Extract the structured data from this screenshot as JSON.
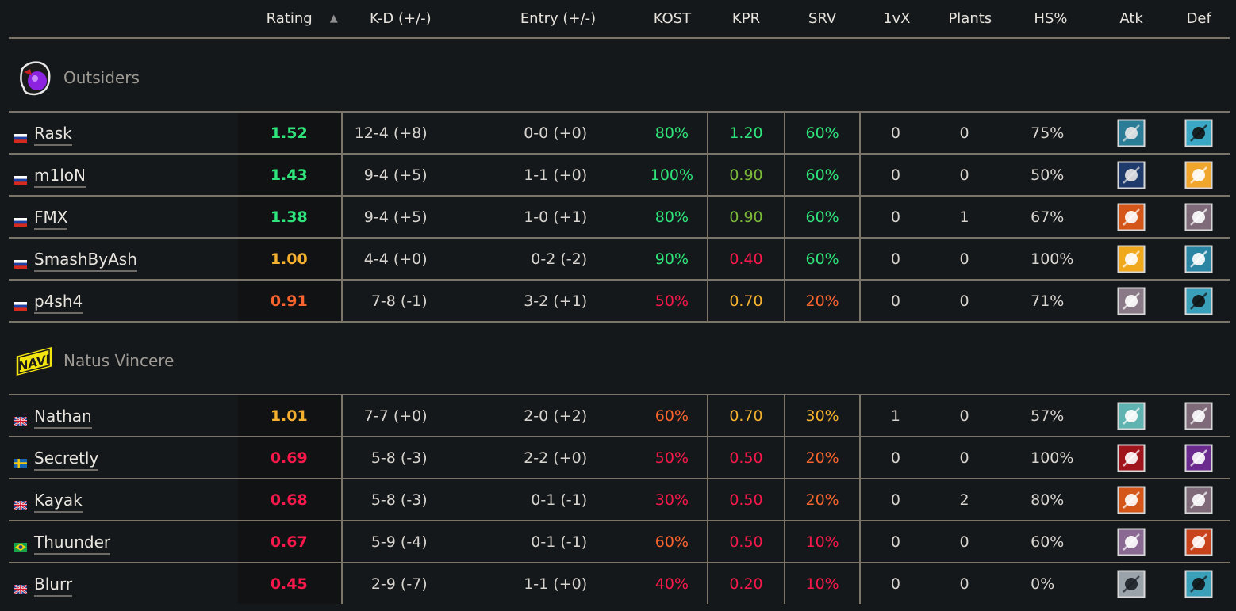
{
  "colors": {
    "green": "#2fe47a",
    "light_green": "#7bb93b",
    "yellow": "#f4b02e",
    "orange": "#f7642e",
    "red": "#f5184a",
    "neutral": "#d8d4cf",
    "background": "#15181b",
    "divider": "#7b7468"
  },
  "headers": {
    "player": "",
    "rating": "Rating",
    "rating_sort": "▲",
    "kd": "K-D (+/-)",
    "entry": "Entry (+/-)",
    "kost": "KOST",
    "kpr": "KPR",
    "srv": "SRV",
    "onevx": "1vX",
    "plants": "Plants",
    "hs": "HS%",
    "atk": "Atk",
    "def": "Def"
  },
  "teams": [
    {
      "name": "Outsiders",
      "logo": "outsiders-logo",
      "players": [
        {
          "flag": "ru",
          "name": "Rask",
          "rating": "1.52",
          "rating_color": "green",
          "kd": "12-4 (+8)",
          "entry": "0-0 (+0)",
          "kost": "80%",
          "kost_color": "green",
          "kpr": "1.20",
          "kpr_color": "green",
          "srv": "60%",
          "srv_color": "green",
          "onevx": "0",
          "plants": "0",
          "hs": "75%",
          "atk": "operator-atk-icon-1",
          "def": "operator-def-icon-1"
        },
        {
          "flag": "ru",
          "name": "m1loN",
          "rating": "1.43",
          "rating_color": "green",
          "kd": "9-4 (+5)",
          "entry": "1-1 (+0)",
          "kost": "100%",
          "kost_color": "green",
          "kpr": "0.90",
          "kpr_color": "light_green",
          "srv": "60%",
          "srv_color": "green",
          "onevx": "0",
          "plants": "0",
          "hs": "50%",
          "atk": "operator-atk-icon-2",
          "def": "operator-def-icon-2"
        },
        {
          "flag": "ru",
          "name": "FMX",
          "rating": "1.38",
          "rating_color": "green",
          "kd": "9-4 (+5)",
          "entry": "1-0 (+1)",
          "kost": "80%",
          "kost_color": "green",
          "kpr": "0.90",
          "kpr_color": "light_green",
          "srv": "60%",
          "srv_color": "green",
          "onevx": "0",
          "plants": "1",
          "hs": "67%",
          "atk": "operator-atk-icon-3",
          "def": "operator-def-icon-3"
        },
        {
          "flag": "ru",
          "name": "SmashByAsh",
          "rating": "1.00",
          "rating_color": "yellow",
          "kd": "4-4 (+0)",
          "entry": "0-2 (-2)",
          "kost": "90%",
          "kost_color": "green",
          "kpr": "0.40",
          "kpr_color": "red",
          "srv": "60%",
          "srv_color": "green",
          "onevx": "0",
          "plants": "0",
          "hs": "100%",
          "atk": "operator-atk-icon-4",
          "def": "operator-def-icon-4"
        },
        {
          "flag": "ru",
          "name": "p4sh4",
          "rating": "0.91",
          "rating_color": "orange",
          "kd": "7-8 (-1)",
          "entry": "3-2 (+1)",
          "kost": "50%",
          "kost_color": "red",
          "kpr": "0.70",
          "kpr_color": "yellow",
          "srv": "20%",
          "srv_color": "orange",
          "onevx": "0",
          "plants": "0",
          "hs": "71%",
          "atk": "operator-atk-icon-5",
          "def": "operator-def-icon-5"
        }
      ]
    },
    {
      "name": "Natus Vincere",
      "logo": "navi-logo",
      "players": [
        {
          "flag": "gb",
          "name": "Nathan",
          "rating": "1.01",
          "rating_color": "yellow",
          "kd": "7-7 (+0)",
          "entry": "2-0 (+2)",
          "kost": "60%",
          "kost_color": "orange",
          "kpr": "0.70",
          "kpr_color": "yellow",
          "srv": "30%",
          "srv_color": "yellow",
          "onevx": "1",
          "plants": "0",
          "hs": "57%",
          "atk": "operator-atk-icon-6",
          "def": "operator-def-icon-3"
        },
        {
          "flag": "se",
          "name": "Secretly",
          "rating": "0.69",
          "rating_color": "red",
          "kd": "5-8 (-3)",
          "entry": "2-2 (+0)",
          "kost": "50%",
          "kost_color": "red",
          "kpr": "0.50",
          "kpr_color": "red",
          "srv": "20%",
          "srv_color": "orange",
          "onevx": "0",
          "plants": "0",
          "hs": "100%",
          "atk": "operator-atk-icon-7",
          "def": "operator-def-icon-6"
        },
        {
          "flag": "gb",
          "name": "Kayak",
          "rating": "0.68",
          "rating_color": "red",
          "kd": "5-8 (-3)",
          "entry": "0-1 (-1)",
          "kost": "30%",
          "kost_color": "red",
          "kpr": "0.50",
          "kpr_color": "red",
          "srv": "20%",
          "srv_color": "orange",
          "onevx": "0",
          "plants": "2",
          "hs": "80%",
          "atk": "operator-atk-icon-3",
          "def": "operator-def-icon-3"
        },
        {
          "flag": "br",
          "name": "Thuunder",
          "rating": "0.67",
          "rating_color": "red",
          "kd": "5-9 (-4)",
          "entry": "0-1 (-1)",
          "kost": "60%",
          "kost_color": "orange",
          "kpr": "0.50",
          "kpr_color": "red",
          "srv": "10%",
          "srv_color": "red",
          "onevx": "0",
          "plants": "0",
          "hs": "60%",
          "atk": "operator-atk-icon-8",
          "def": "operator-def-icon-7"
        },
        {
          "flag": "gb",
          "name": "Blurr",
          "rating": "0.45",
          "rating_color": "red",
          "kd": "2-9 (-7)",
          "entry": "1-1 (+0)",
          "kost": "40%",
          "kost_color": "red",
          "kpr": "0.20",
          "kpr_color": "red",
          "srv": "10%",
          "srv_color": "red",
          "onevx": "0",
          "plants": "0",
          "hs": "0%",
          "atk": "operator-atk-icon-9",
          "def": "operator-def-icon-5"
        }
      ]
    }
  ]
}
